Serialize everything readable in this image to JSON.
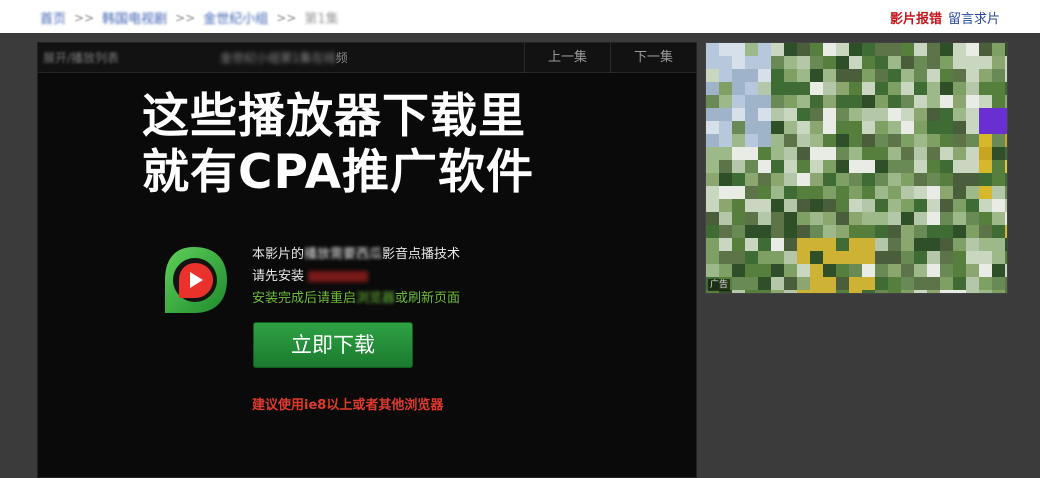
{
  "breadcrumb": {
    "items": [
      "首页",
      "韩国电视剧",
      "金世纪小组",
      "第1集"
    ],
    "separator": ">>"
  },
  "top_links": {
    "report": "影片报错",
    "message": "留言求片"
  },
  "player": {
    "header_left": "展开/播放列表",
    "header_mid_blur": "金世纪小组第1集在线",
    "header_mid_suffix": "频",
    "prev_label": "上一集",
    "next_label": "下一集"
  },
  "overlay": {
    "line1": "这些播放器下载里",
    "line2": "就有CPA推广软件"
  },
  "install": {
    "line1_visible": "本影片的",
    "line1_blur": "播放需要西瓜",
    "line1_tail": "影音点播技术",
    "line2": "请先安装",
    "line3_visible": "安装完成后请重启",
    "line3_blur": "浏览器",
    "line3_tail": "或刷新页面",
    "download_button": "立即下载",
    "browser_tip": "建议使用ie8以上或者其他浏览器"
  },
  "ad": {
    "tag": "广告"
  },
  "colors": {
    "report": "#c4161c",
    "install_hint": "#6dbb3a",
    "button": "#2fa245",
    "tip": "#e03a2e"
  }
}
